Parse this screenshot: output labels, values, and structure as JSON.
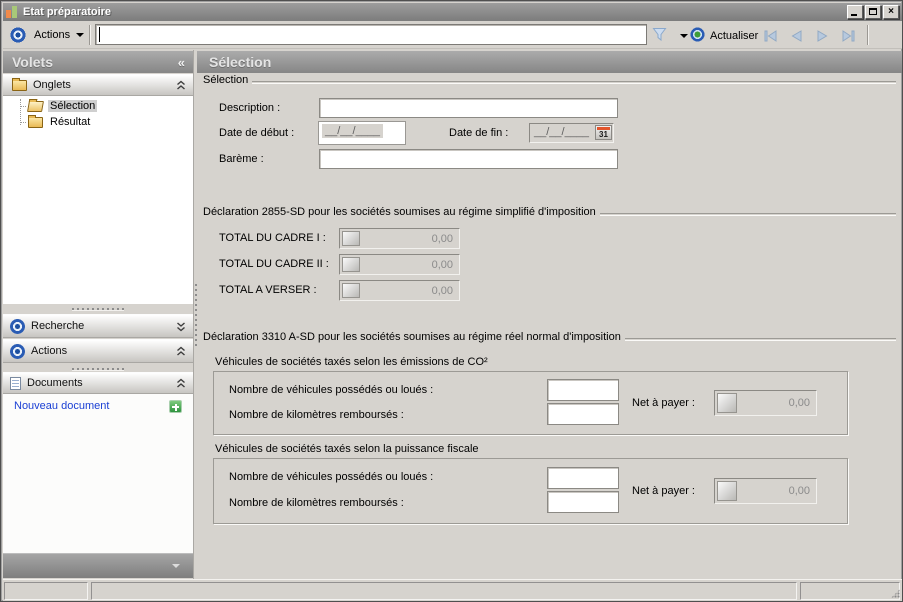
{
  "window": {
    "title": "Etat préparatoire"
  },
  "toolbar": {
    "actions_label": "Actions",
    "search_value": "",
    "refresh_label": "Actualiser"
  },
  "sidebar": {
    "title": "Volets",
    "collapse_glyph": "«",
    "sections": {
      "onglets": {
        "label": "Onglets"
      },
      "recherche": {
        "label": "Recherche"
      },
      "actions": {
        "label": "Actions"
      },
      "documents": {
        "label": "Documents",
        "new_document_label": "Nouveau document"
      }
    },
    "tree": [
      {
        "label": "Sélection"
      },
      {
        "label": "Résultat"
      }
    ]
  },
  "main": {
    "header": "Sélection",
    "selection_group": {
      "label": "Sélection",
      "description_label": "Description :",
      "date_start_label": "Date de début :",
      "date_end_label": "Date de fin :",
      "date_mask": "__/__/____",
      "calendar_day": "31",
      "bareme_label": "Barème :"
    },
    "decl_2855": {
      "label": "Déclaration 2855-SD pour les sociétés soumises au régime simplifié d'imposition",
      "rows": [
        {
          "label": "TOTAL DU CADRE I :",
          "value": "0,00"
        },
        {
          "label": "TOTAL DU CADRE II :",
          "value": "0,00"
        },
        {
          "label": "TOTAL A VERSER :",
          "value": "0,00"
        }
      ]
    },
    "decl_3310": {
      "label": "Déclaration 3310 A-SD pour les sociétés soumises au régime réel normal d'imposition",
      "groups": [
        {
          "title": "Véhicules de sociétés taxés selon les émissions de CO²",
          "vehicles_label": "Nombre de véhicules possédés ou loués :",
          "km_label": "Nombre de kilomètres remboursés :",
          "net_label": "Net à payer :",
          "net_value": "0,00"
        },
        {
          "title": "Véhicules de sociétés taxés selon la puissance fiscale",
          "vehicles_label": "Nombre de véhicules possédés ou loués :",
          "km_label": "Nombre de kilomètres remboursés :",
          "net_label": "Net à payer :",
          "net_value": "0,00"
        }
      ]
    }
  }
}
